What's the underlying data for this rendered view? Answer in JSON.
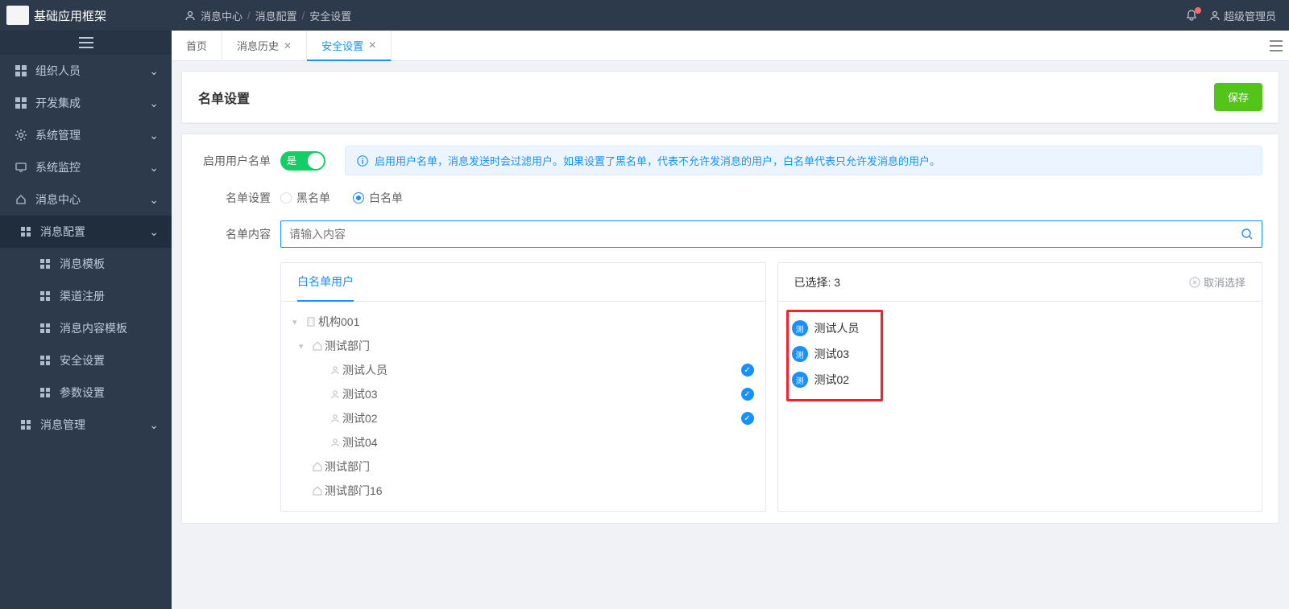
{
  "app": {
    "title": "基础应用框架",
    "user": "超级管理员"
  },
  "breadcrumb": {
    "a": "消息中心",
    "b": "消息配置",
    "c": "安全设置"
  },
  "sidebar": {
    "items": [
      {
        "label": "组织人员"
      },
      {
        "label": "开发集成"
      },
      {
        "label": "系统管理"
      },
      {
        "label": "系统监控"
      },
      {
        "label": "消息中心"
      },
      {
        "label": "消息配置"
      },
      {
        "label": "消息模板"
      },
      {
        "label": "渠道注册"
      },
      {
        "label": "消息内容模板"
      },
      {
        "label": "安全设置"
      },
      {
        "label": "参数设置"
      },
      {
        "label": "消息管理"
      }
    ]
  },
  "tabs": [
    {
      "label": "首页",
      "closable": false
    },
    {
      "label": "消息历史",
      "closable": true
    },
    {
      "label": "安全设置",
      "closable": true,
      "active": true
    }
  ],
  "page": {
    "title": "名单设置",
    "save": "保存",
    "enable_label": "启用用户名单",
    "switch_text": "是",
    "alert": "启用用户名单，消息发送时会过滤用户。如果设置了黑名单，代表不允许发消息的用户，白名单代表只允许发消息的用户。",
    "list_type_label": "名单设置",
    "radio_black": "黑名单",
    "radio_white": "白名单",
    "content_label": "名单内容",
    "search_placeholder": "请输入内容",
    "left_tab": "白名单用户",
    "selected_prefix": "已选择: ",
    "selected_count": "3",
    "cancel_sel": "取消选择",
    "avatar_char": "测"
  },
  "tree": [
    {
      "label": "机构001",
      "type": "org",
      "level": 0,
      "expanded": true
    },
    {
      "label": "测试部门",
      "type": "dept",
      "level": 1,
      "expanded": true
    },
    {
      "label": "测试人员",
      "type": "user",
      "level": 2,
      "checked": true
    },
    {
      "label": "测试03",
      "type": "user",
      "level": 2,
      "checked": true
    },
    {
      "label": "测试02",
      "type": "user",
      "level": 2,
      "checked": true
    },
    {
      "label": "测试04",
      "type": "user",
      "level": 2,
      "checked": false
    },
    {
      "label": "测试部门",
      "type": "dept",
      "level": 1,
      "expanded": false
    },
    {
      "label": "测试部门16",
      "type": "dept",
      "level": 1,
      "expanded": false
    }
  ],
  "selected": [
    {
      "label": "测试人员"
    },
    {
      "label": "测试03"
    },
    {
      "label": "测试02"
    }
  ]
}
